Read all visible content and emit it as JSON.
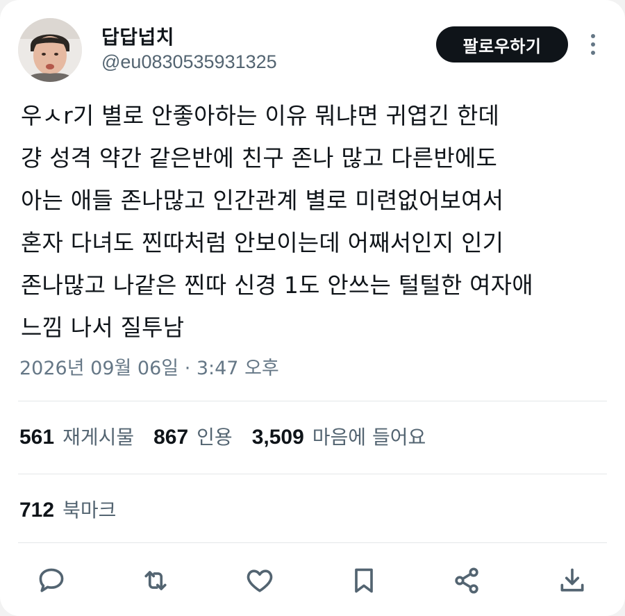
{
  "author": {
    "display_name": "답답넙치",
    "handle": "@eu0830535931325"
  },
  "follow_button_label": "팔로우하기",
  "more_icon": "more-vertical-icon",
  "tweet": {
    "lines": [
      "우ㅅr기 별로 안좋아하는 이유 뭐냐면 귀엽긴 한데",
      "걍 성격 약간 같은반에 친구 존나 많고 다른반에도",
      "아는 애들 존나많고 인간관계 별로 미련없어보여서",
      "혼자 다녀도 찐따처럼 안보이는데 어째서인지 인기",
      "존나많고 나같은 찐따 신경 1도 안쓰는 털털한 여자애",
      "느낌 나서 질투남"
    ],
    "timestamp": "2026년 09월 06일 · 3:47 오후"
  },
  "stats": {
    "reposts": {
      "count": "561",
      "label": "재게시물"
    },
    "quotes": {
      "count": "867",
      "label": "인용"
    },
    "likes": {
      "count": "3,509",
      "label": "마음에 들어요"
    },
    "bookmarks": {
      "count": "712",
      "label": "북마크"
    }
  },
  "actions": [
    "reply-icon",
    "repost-icon",
    "like-icon",
    "bookmark-icon",
    "share-icon",
    "download-icon"
  ],
  "colors": {
    "text": "#0f1419",
    "secondary": "#536471",
    "button_bg": "#0f1419",
    "icon": "#536471"
  }
}
